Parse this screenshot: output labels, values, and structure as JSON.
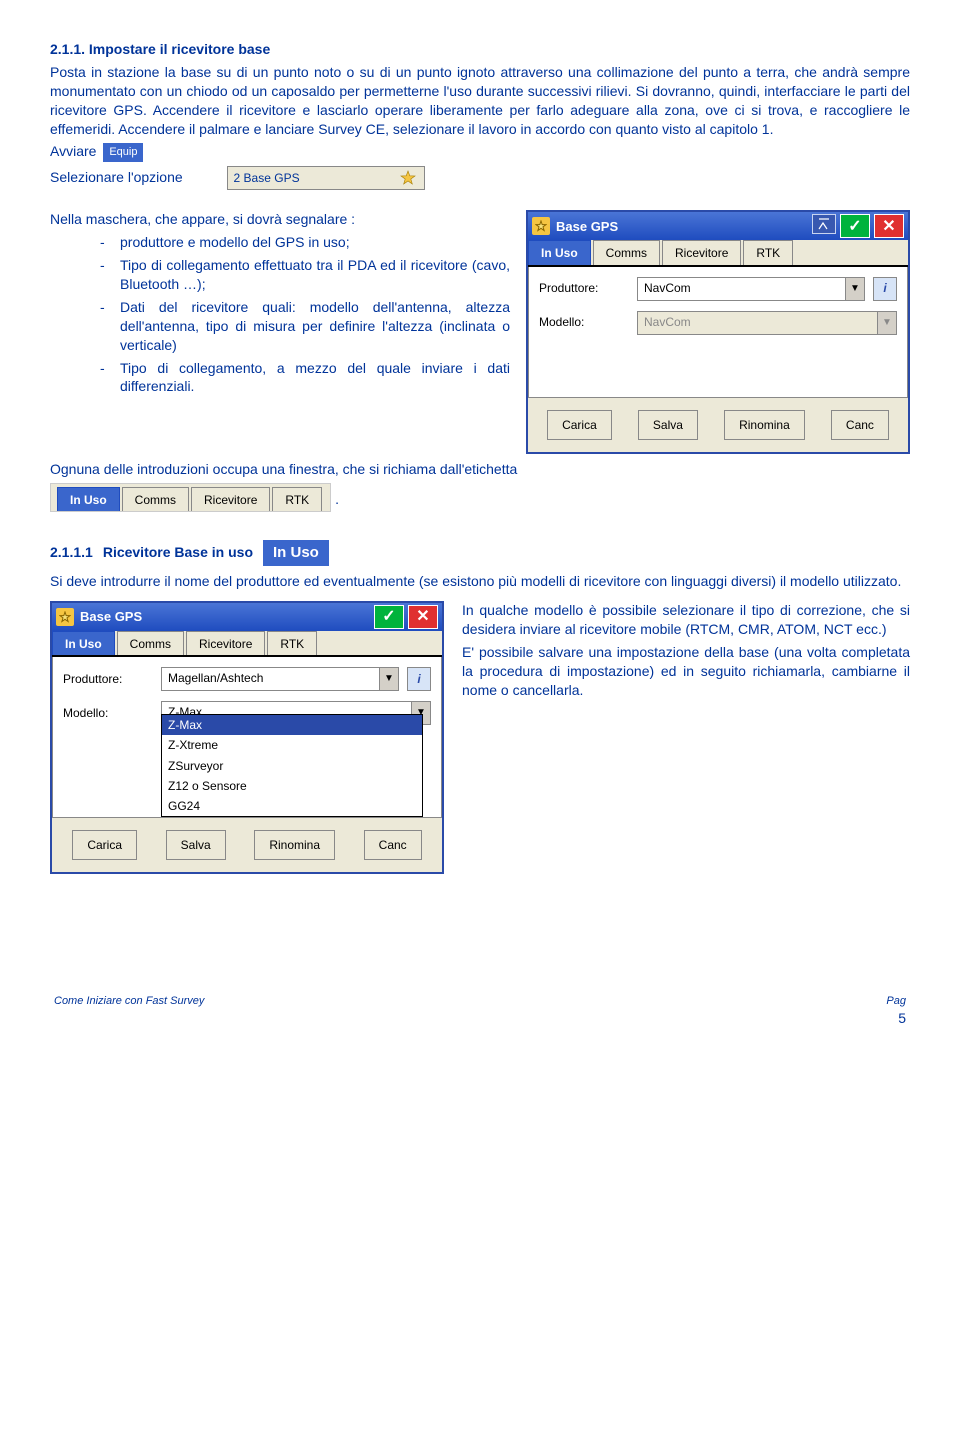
{
  "section": {
    "number": "2.1.1.",
    "title": "Impostare il ricevitore base",
    "body1": "Posta in stazione la base su di un punto noto o su di un punto ignoto attraverso una collimazione del punto a terra, che andrà sempre monumentato con un chiodo od un caposaldo per permetterne l'uso durante successivi rilievi. Si dovranno, quindi, interfacciare le parti del ricevitore GPS.  Accendere il ricevitore e lasciarlo operare liberamente per farlo adeguare alla zona, ove ci si trova, e raccogliere le effemeridi. Accendere il palmare e lanciare Survey CE, selezionare il lavoro in accordo con quanto visto al capitolo 1.",
    "avviare": "Avviare",
    "equip_chip": "Equip",
    "selezionare": "Selezionare l'opzione",
    "option_label": "2 Base GPS",
    "mask_intro": "Nella maschera, che appare, si dovrà segnalare :",
    "bullets": [
      "produttore e modello del GPS in uso;",
      "Tipo di collegamento effettuato tra il PDA ed il ricevitore (cavo, Bluetooth …);",
      "Dati del ricevitore quali: modello dell'antenna, altezza dell'antenna, tipo di misura per definire l'altezza (inclinata o verticale)",
      "Tipo di collegamento, a mezzo del quale inviare i dati differenziali."
    ],
    "after_bullets": "Ognuna delle introduzioni occupa una finestra, che si richiama dall'etichetta"
  },
  "window1": {
    "title": "Base GPS",
    "tabs": [
      "In Uso",
      "Comms",
      "Ricevitore",
      "RTK"
    ],
    "active_tab": "In Uso",
    "prod_label": "Produttore:",
    "prod_value": "NavCom",
    "mod_label": "Modello:",
    "mod_value": "NavCom",
    "buttons": [
      "Carica",
      "Salva",
      "Rinomina",
      "Canc"
    ]
  },
  "sub": {
    "number": "2.1.1.1",
    "title": "Ricevitore Base in uso",
    "chip": "In Uso",
    "body": "Si deve introdurre il nome del produttore ed eventualmente (se esistono più modelli di ricevitore con linguaggi diversi) il modello utilizzato.",
    "right1": "In qualche modello è possibile selezionare il tipo di correzione, che si desidera inviare al ricevitore mobile (RTCM, CMR, ATOM, NCT ecc.)",
    "right2": "E' possibile salvare una impostazione della base (una volta completata la procedura di impostazione) ed in seguito richiamarla, cambiarne il nome o cancellarla."
  },
  "window2": {
    "title": "Base GPS",
    "tabs": [
      "In Uso",
      "Comms",
      "Ricevitore",
      "RTK"
    ],
    "active_tab": "In Uso",
    "prod_label": "Produttore:",
    "prod_value": "Magellan/Ashtech",
    "mod_label": "Modello:",
    "mod_value": "Z-Max",
    "options": [
      "Z-Max",
      "Z-Xtreme",
      "ZSurveyor",
      "Z12 o Sensore",
      "GG24"
    ],
    "buttons": [
      "Carica",
      "Salva",
      "Rinomina",
      "Canc"
    ]
  },
  "footer": {
    "left": "Come Iniziare con Fast Survey",
    "label": "Pag",
    "num": "5"
  }
}
